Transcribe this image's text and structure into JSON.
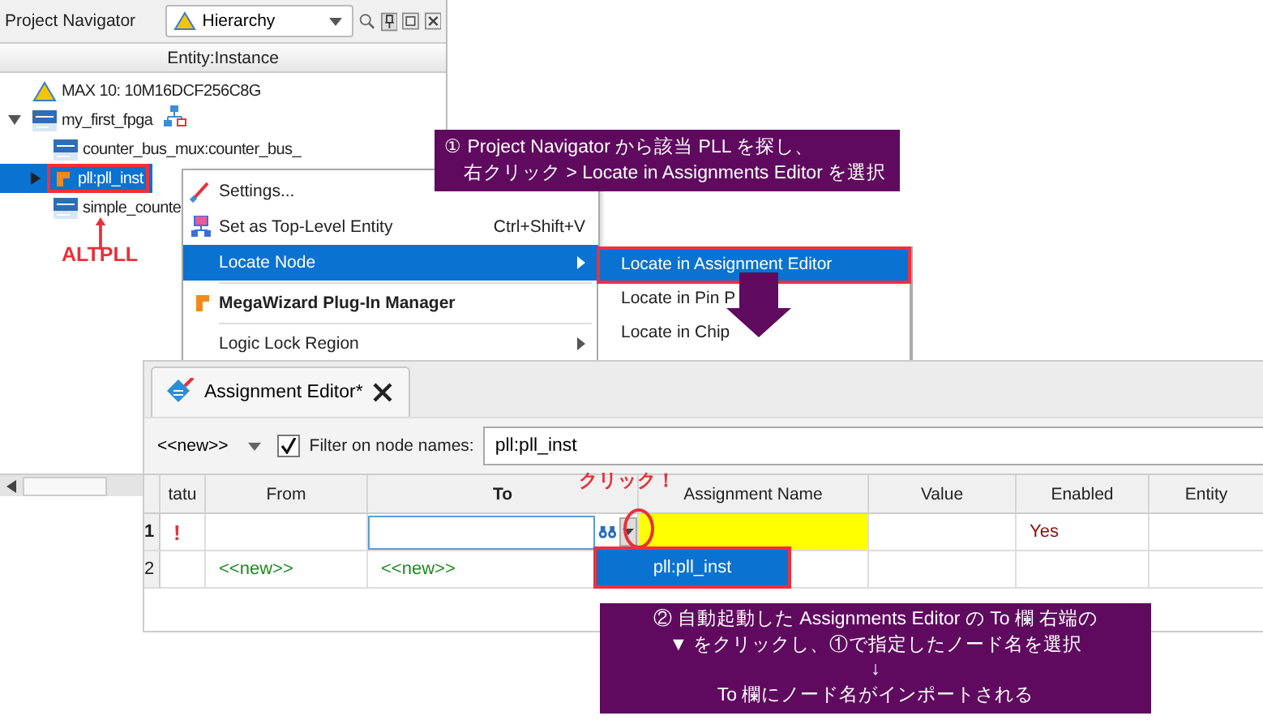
{
  "project_navigator": {
    "title": "Project Navigator",
    "view_dropdown": "Hierarchy",
    "column_header": "Entity:Instance",
    "tree": [
      {
        "label": "MAX 10: 10M16DCF256C8G",
        "kind": "device",
        "selected": false,
        "annotated": false
      },
      {
        "label": "my_first_fpga",
        "kind": "entity",
        "selected": false,
        "annotated": false,
        "top_level": true,
        "expanded": true,
        "children": [
          {
            "label": "counter_bus_mux:counter_bus_",
            "kind": "entity",
            "selected": false,
            "annotated": false
          },
          {
            "label": "pll:pll_inst",
            "kind": "megafunction",
            "selected": true,
            "annotated": true,
            "expanded": false
          },
          {
            "label": "simple_counte",
            "kind": "entity",
            "selected": false,
            "annotated": false
          }
        ]
      }
    ],
    "annotation": "ALTPLL"
  },
  "context_menu": {
    "items": [
      {
        "kind": "settings",
        "label": "Settings...",
        "highlighted": false,
        "bold": false,
        "submenu": false
      },
      {
        "kind": "toplevel",
        "label": "Set as Top-Level Entity",
        "shortcut": "Ctrl+Shift+V",
        "highlighted": false,
        "bold": false,
        "submenu": false
      },
      {
        "kind": "plain",
        "label": "Locate Node",
        "highlighted": true,
        "bold": false,
        "submenu": true
      },
      {
        "kind": "separator"
      },
      {
        "kind": "wizard",
        "label": "MegaWizard Plug-In Manager",
        "highlighted": false,
        "bold": true,
        "submenu": false
      },
      {
        "kind": "separator"
      },
      {
        "kind": "plain",
        "label": "Logic Lock Region",
        "highlighted": false,
        "bold": false,
        "submenu": true
      }
    ]
  },
  "submenu": {
    "items": [
      {
        "label": "Locate in Assignment Editor",
        "highlighted": true,
        "annotated": true
      },
      {
        "label": "Locate in Pin P",
        "highlighted": false,
        "annotated": false
      },
      {
        "label": "Locate in Chip",
        "highlighted": false,
        "annotated": false
      }
    ]
  },
  "callout_1": [
    "① Project Navigator から該当 PLL を探し、",
    "右クリック > Locate in Assignments Editor を選択"
  ],
  "assignment_editor": {
    "tab": {
      "label": "Assignment Editor*",
      "selected": true
    },
    "new_dropdown": "<<new>>",
    "filter_checked": true,
    "filter_label": "Filter on node names:",
    "filter_value": "pll:pll_inst",
    "columns": [
      "tatu",
      "From",
      "To",
      "Assignment Name",
      "Value",
      "Enabled",
      "Entity"
    ],
    "rows": [
      {
        "number": "1",
        "status": "!",
        "editing": true,
        "name_highlighted": true,
        "enabled": "Yes"
      },
      {
        "number": "2",
        "from": "<<new>>",
        "to": "<<new>>",
        "editing": false,
        "name_highlighted": false
      }
    ],
    "click_label": "クリック！",
    "dropdown_options": [
      {
        "label": "pll:pll_inst",
        "selected": true,
        "annotated": true
      }
    ]
  },
  "callout_2": [
    "② 自動起動した Assignments Editor の To 欄 右端の",
    "▼ をクリックし、①で指定したノード名を選択",
    "↓",
    "To 欄にノード名がインポートされる"
  ]
}
